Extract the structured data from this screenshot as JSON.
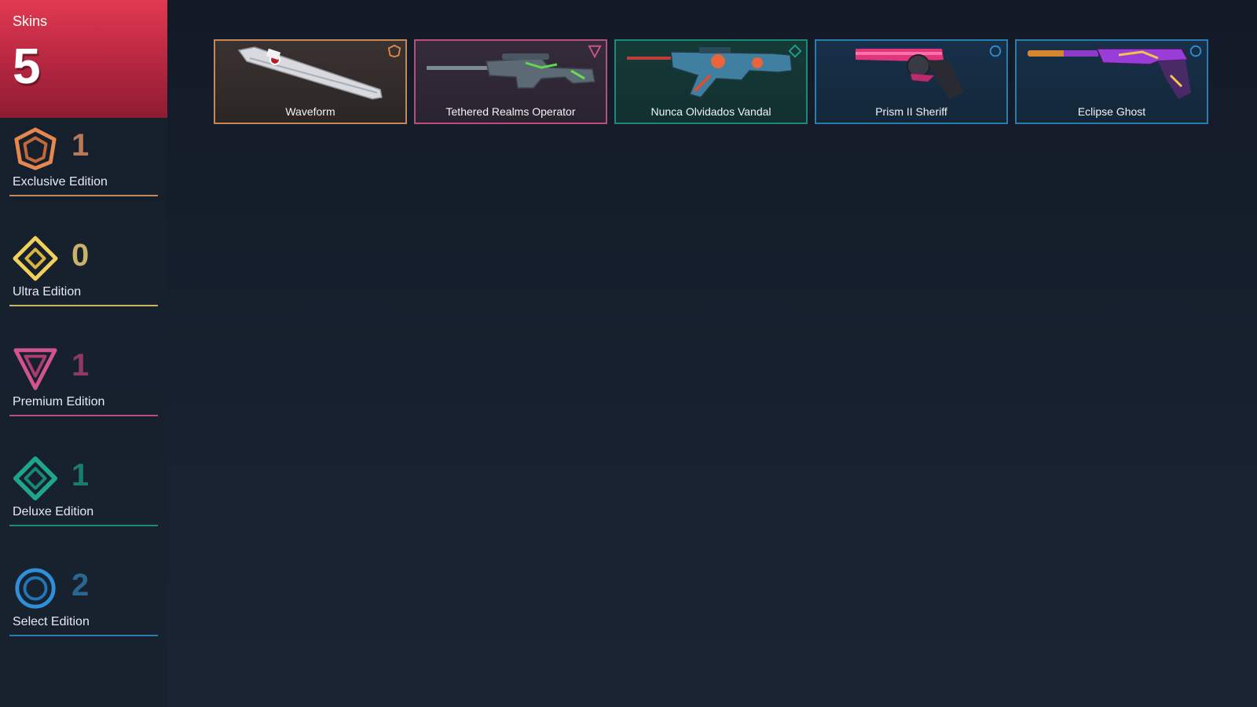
{
  "summary": {
    "label": "Skins",
    "total": "5"
  },
  "colors": {
    "exclusive": "#e5884f",
    "ultra": "#f2d15a",
    "premium": "#d1548c",
    "deluxe": "#1fa58e",
    "select": "#2f8fd8",
    "accent": "#e23a50"
  },
  "tiers": [
    {
      "label": "Exclusive Edition",
      "count": "1",
      "icon": "exclusive-edition-icon"
    },
    {
      "label": "Ultra Edition",
      "count": "0",
      "icon": "ultra-edition-icon"
    },
    {
      "label": "Premium Edition",
      "count": "1",
      "icon": "premium-edition-icon"
    },
    {
      "label": "Deluxe Edition",
      "count": "1",
      "icon": "deluxe-edition-icon"
    },
    {
      "label": "Select Edition",
      "count": "2",
      "icon": "select-edition-icon"
    }
  ],
  "skins": [
    {
      "name": "Waveform",
      "tier": "Exclusive Edition"
    },
    {
      "name": "Tethered Realms Operator",
      "tier": "Premium Edition"
    },
    {
      "name": "Nunca Olvidados Vandal",
      "tier": "Deluxe Edition"
    },
    {
      "name": "Prism II Sheriff",
      "tier": "Select Edition"
    },
    {
      "name": "Eclipse Ghost",
      "tier": "Select Edition"
    }
  ]
}
